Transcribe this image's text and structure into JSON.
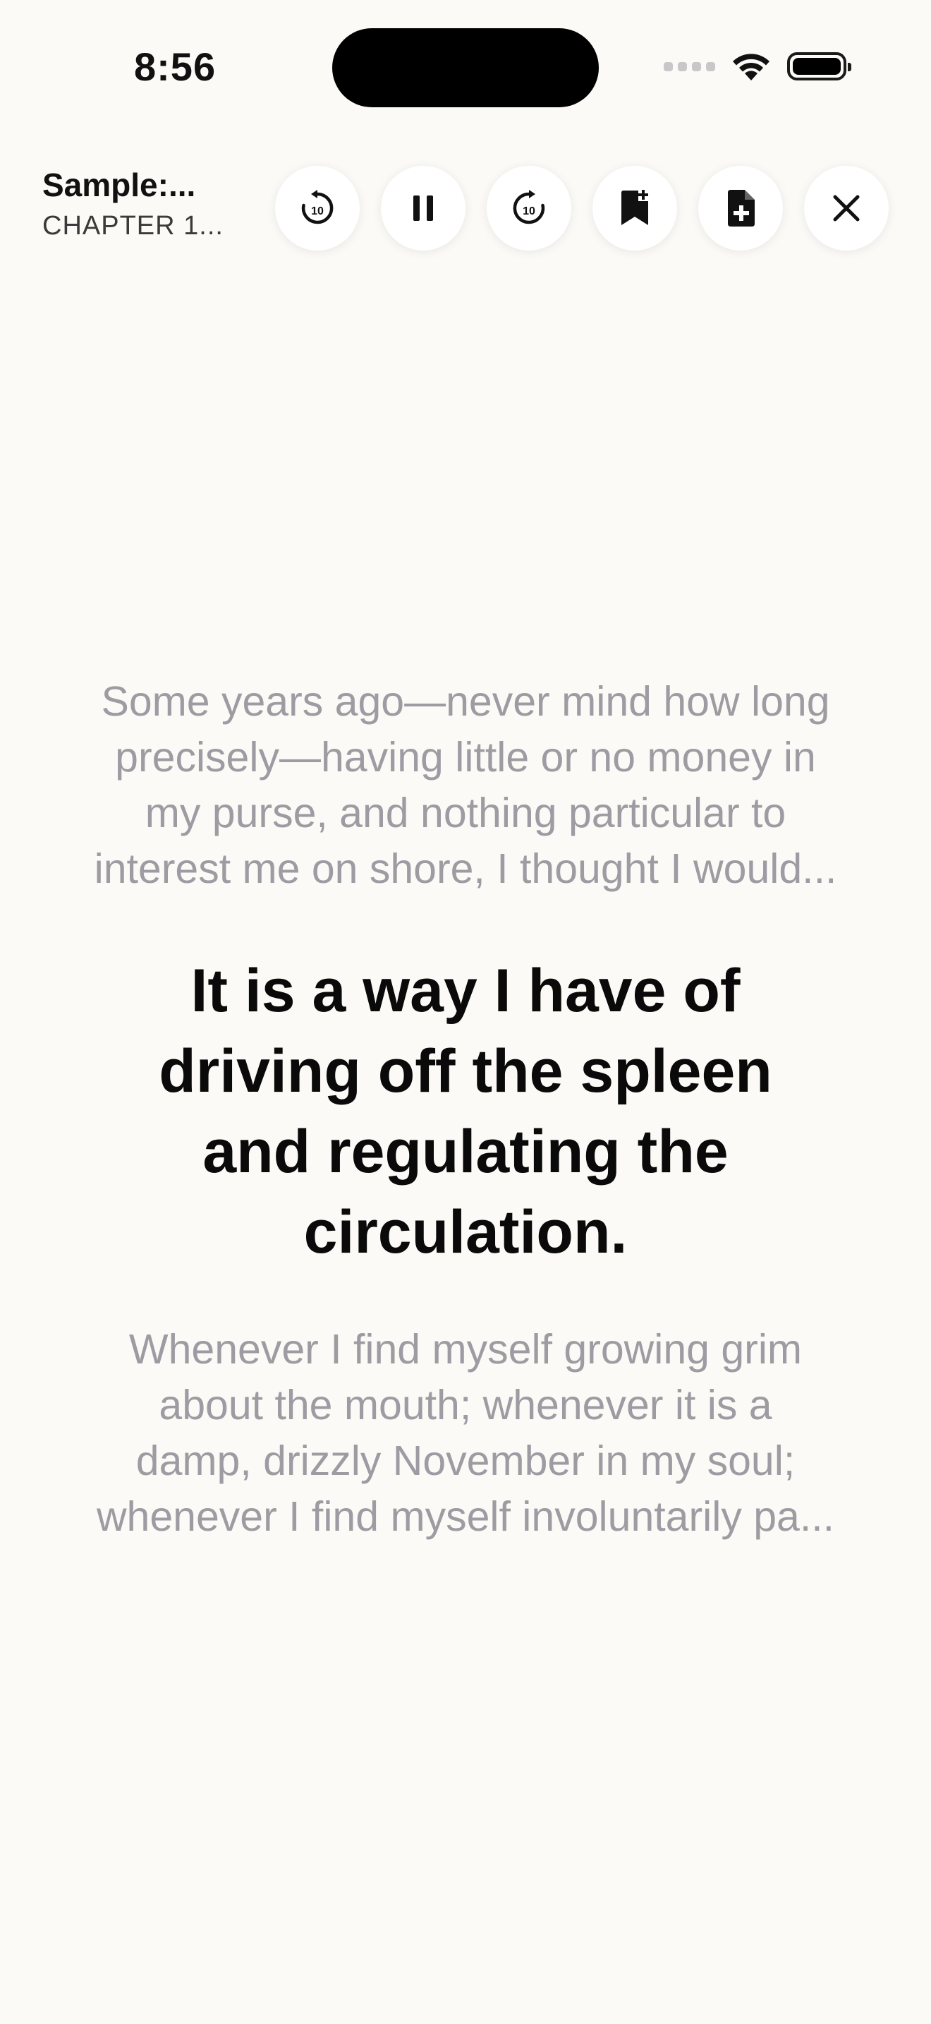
{
  "status_bar": {
    "time": "8:56"
  },
  "header": {
    "book_title": "Sample:...",
    "chapter": "CHAPTER 1..."
  },
  "controls": [
    {
      "name": "skip-back-10-button",
      "icon": "rewind-10-icon",
      "label": "10"
    },
    {
      "name": "pause-button",
      "icon": "pause-icon"
    },
    {
      "name": "skip-forward-10-button",
      "icon": "forward-10-icon",
      "label": "10"
    },
    {
      "name": "add-bookmark-button",
      "icon": "bookmark-plus-icon"
    },
    {
      "name": "add-note-button",
      "icon": "document-plus-icon"
    },
    {
      "name": "close-button",
      "icon": "close-icon"
    }
  ],
  "reader": {
    "previous_paragraph": [
      "Some years ago—never mind how long",
      "precisely—having little or no money in",
      "my purse, and nothing particular to",
      "interest me on shore, I thought I would..."
    ],
    "current_sentence": "It is a way I have of driving off the spleen and regulating the circulation.",
    "next_paragraph": [
      "Whenever I find myself growing grim",
      "about the mouth; whenever it is a",
      "damp, drizzly November in my soul;",
      "whenever I find myself involuntarily pa..."
    ]
  },
  "colors": {
    "background": "#fbfaf6",
    "dimmed_text": "#9c9ca2",
    "active_text": "#0a0a0a"
  }
}
